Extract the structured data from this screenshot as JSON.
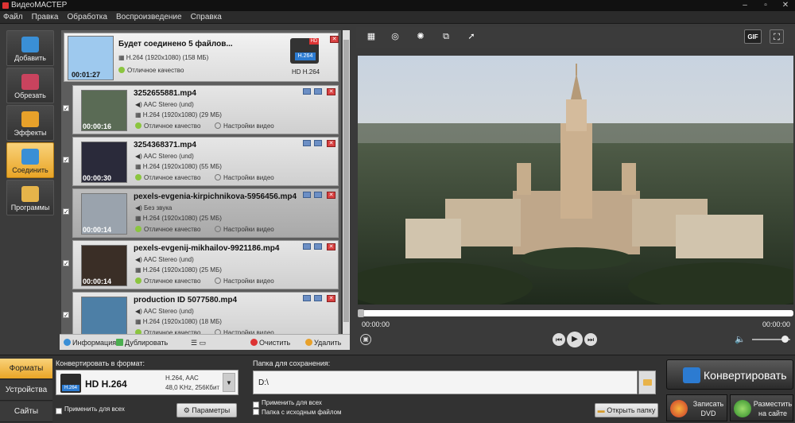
{
  "window": {
    "title": "ВидеоМАСТЕР"
  },
  "menu": [
    "Файл",
    "Правка",
    "Обработка",
    "Воспроизведение",
    "Справка"
  ],
  "nav": [
    {
      "label": "Добавить",
      "icon": "add-video-icon",
      "color": "#3a8fd6"
    },
    {
      "label": "Обрезать",
      "icon": "cut-video-icon",
      "color": "#c9435e"
    },
    {
      "label": "Эффекты",
      "icon": "effects-icon",
      "color": "#e8a12a"
    },
    {
      "label": "Соединить",
      "icon": "join-icon",
      "color": "#3a8fd6"
    },
    {
      "label": "Программы",
      "icon": "programs-icon",
      "color": "#e6b44a"
    }
  ],
  "joined": {
    "title": "Будет соединено 5 файлов...",
    "info": "H.264 (1920x1080) (158 МБ)",
    "quality": "Отличное качество",
    "duration": "00:01:27",
    "badge": "H.264",
    "badge_caption": "HD H.264",
    "hd_label": "HD"
  },
  "files": [
    {
      "name": "3252655881.mp4",
      "audio": "AAC Stereo (und)",
      "video": "H.264 (1920x1080) (29 МБ)",
      "quality": "Отличное качество",
      "settings": "Настройки видео",
      "duration": "00:00:16",
      "thumb": "#5a6b55",
      "checkbox": "✓"
    },
    {
      "name": "3254368371.mp4",
      "audio": "AAC Stereo (und)",
      "video": "H.264 (1920x1080) (55 МБ)",
      "quality": "Отличное качество",
      "settings": "Настройки видео",
      "duration": "00:00:30",
      "thumb": "#2a2a3a",
      "checkbox": "✓"
    },
    {
      "name": "pexels-evgenia-kirpichnikova-5956456.mp4",
      "audio": "Без звука",
      "video": "H.264 (1920x1080) (25 МБ)",
      "quality": "Отличное качество",
      "settings": "Настройки видео",
      "duration": "00:00:14",
      "thumb": "#9aa3ad",
      "checkbox": "✓"
    },
    {
      "name": "pexels-evgenij-mikhailov-9921186.mp4",
      "audio": "AAC Stereo (und)",
      "video": "H.264 (1920x1080) (25 МБ)",
      "quality": "Отличное качество",
      "settings": "Настройки видео",
      "duration": "00:00:14",
      "thumb": "#3a2e26",
      "checkbox": "✓"
    },
    {
      "name": "production ID 5077580.mp4",
      "audio": "AAC Stereo (und)",
      "video": "H.264 (1920x1080) (18 МБ)",
      "quality": "Отличное качество",
      "settings": "Настройки видео",
      "duration": "",
      "thumb": "#4d7fa6",
      "checkbox": "✓"
    }
  ],
  "listbar": {
    "info": "Информация",
    "duplicate": "Дублировать",
    "clear": "Очистить",
    "delete": "Удалить"
  },
  "player": {
    "time_start": "00:00:00",
    "time_end": "00:00:00",
    "gif_label": "GIF",
    "progress_fraction": 0.0,
    "volume_fraction": 0.85
  },
  "bottom": {
    "tabs": [
      "Форматы",
      "Устройства",
      "Сайты"
    ],
    "format_label": "Конвертировать в формат:",
    "format_name": "HD H.264",
    "format_detail1": "H.264, AAC",
    "format_detail2": "48,0 KHz, 256Кбит",
    "format_icon_text": "H.264",
    "apply_all": "Применить для всех",
    "params": "Параметры",
    "save_label": "Папка для сохранения:",
    "save_path": "D:\\",
    "apply_all2": "Применить для всех",
    "same_folder": "Папка с исходным файлом",
    "open_folder": "Открыть папку",
    "checkmark": "✓",
    "convert": "Конвертировать",
    "burn": "Записать DVD",
    "publish": "Разместить на сайте"
  }
}
